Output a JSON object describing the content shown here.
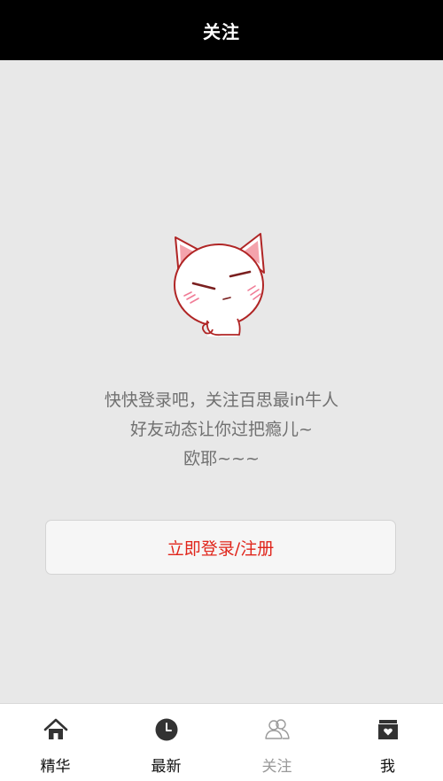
{
  "header": {
    "title": "关注"
  },
  "main": {
    "illustration": "cat-mascot",
    "message_lines": [
      "快快登录吧，关注百思最in牛人",
      "好友动态让你过把瘾儿~",
      "欧耶~~~"
    ],
    "login_button_label": "立即登录/注册"
  },
  "tabbar": {
    "tabs": [
      {
        "label": "精华",
        "icon": "home-icon",
        "active": false
      },
      {
        "label": "最新",
        "icon": "clock-icon",
        "active": false
      },
      {
        "label": "关注",
        "icon": "friends-icon",
        "active": true
      },
      {
        "label": "我",
        "icon": "profile-box-icon",
        "active": false
      }
    ]
  },
  "colors": {
    "navbar_bg": "#000000",
    "content_bg": "#e8e8e8",
    "accent_red": "#e0251b",
    "message_gray": "#707070",
    "inactive_tab_gray": "#9a9a9a"
  }
}
